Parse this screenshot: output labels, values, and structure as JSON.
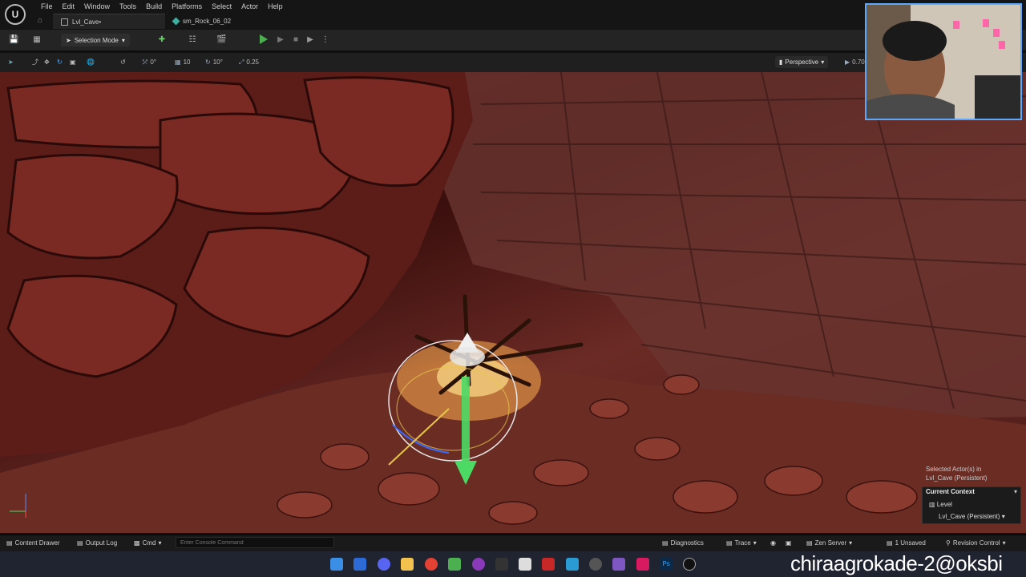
{
  "menu": [
    "File",
    "Edit",
    "Window",
    "Tools",
    "Build",
    "Select",
    "Actor",
    "Help"
  ],
  "menu_extra": "Platforms",
  "tabs": [
    {
      "label": "Lvl_Cave•",
      "active": true
    },
    {
      "label": "sm_Rock_06_02",
      "active": false
    }
  ],
  "toolbar": {
    "mode_label": "Selection Mode",
    "play_color": "#4caf50"
  },
  "viewport_toolbar": {
    "rotation_snap": "0°",
    "grid_snap": "10",
    "angle_snap": "10°",
    "scale_snap": "0.25",
    "view_mode": "Perspective",
    "camera_speed": "0.70"
  },
  "context_panel": {
    "selected_line1": "Selected Actor(s) in",
    "selected_line2": "Lvl_Cave (Persistent)",
    "title": "Current Context",
    "level_label": "Level",
    "level_value": "Lvl_Cave (Persistent)"
  },
  "status_bar": {
    "content_drawer": "Content Drawer",
    "output_log": "Output Log",
    "cmd": "Cmd",
    "console_placeholder": "Enter Console Command",
    "diagnostics": "Diagnostics",
    "trace": "Trace",
    "zen_server": "Zen Server",
    "unsaved": "1 Unsaved",
    "revision_control": "Revision Control"
  },
  "watermark": "chiraagrokade-2@oksbi",
  "icons": {
    "ue_logo": "unreal-logo-icon",
    "home": "home-icon",
    "save": "save-icon",
    "play": "play-icon"
  }
}
